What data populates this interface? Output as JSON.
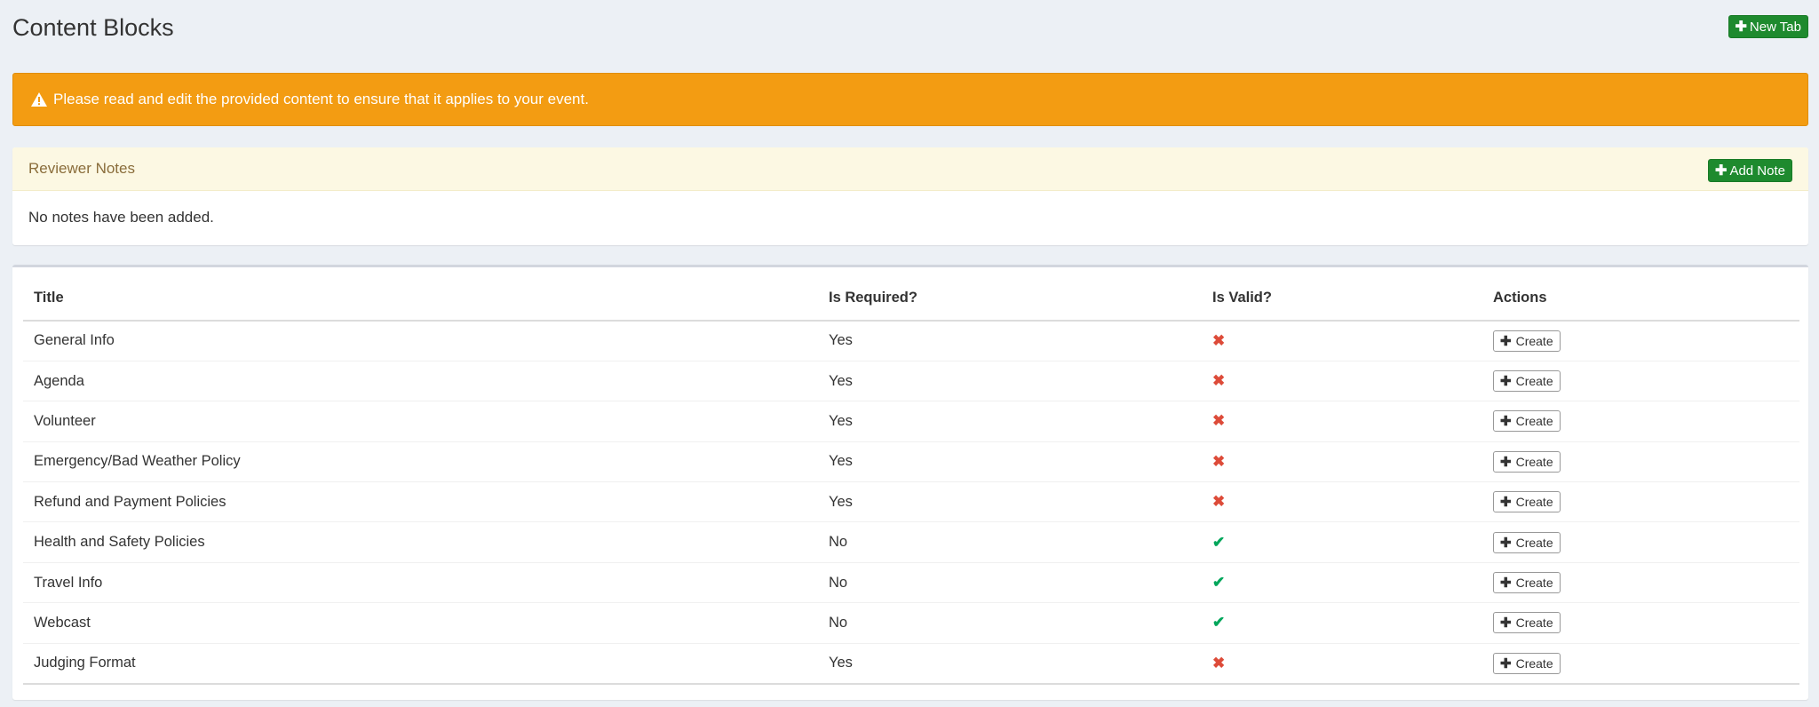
{
  "header": {
    "title": "Content Blocks",
    "new_tab_label": "New Tab"
  },
  "alert": {
    "message": "Please read and edit the provided content to ensure that it applies to your event.",
    "color": "#f39c12"
  },
  "notes": {
    "title": "Reviewer Notes",
    "add_label": "Add Note",
    "empty_message": "No notes have been added."
  },
  "table": {
    "columns": [
      "Title",
      "Is Required?",
      "Is Valid?",
      "Actions"
    ],
    "rows": [
      {
        "title": "General Info",
        "required": "Yes",
        "valid": false,
        "action": "Create"
      },
      {
        "title": "Agenda",
        "required": "Yes",
        "valid": false,
        "action": "Create"
      },
      {
        "title": "Volunteer",
        "required": "Yes",
        "valid": false,
        "action": "Create"
      },
      {
        "title": "Emergency/Bad Weather Policy",
        "required": "Yes",
        "valid": false,
        "action": "Create"
      },
      {
        "title": "Refund and Payment Policies",
        "required": "Yes",
        "valid": false,
        "action": "Create"
      },
      {
        "title": "Health and Safety Policies",
        "required": "No",
        "valid": true,
        "action": "Create"
      },
      {
        "title": "Travel Info",
        "required": "No",
        "valid": true,
        "action": "Create"
      },
      {
        "title": "Webcast",
        "required": "No",
        "valid": true,
        "action": "Create"
      },
      {
        "title": "Judging Format",
        "required": "Yes",
        "valid": false,
        "action": "Create"
      }
    ]
  },
  "colors": {
    "valid": "#00a65a",
    "invalid": "#dd4b39",
    "primary_green": "#1e8a2e"
  },
  "icons": {
    "valid": "check-icon",
    "invalid": "x-icon",
    "add": "plus-icon",
    "warning": "warning-icon"
  }
}
